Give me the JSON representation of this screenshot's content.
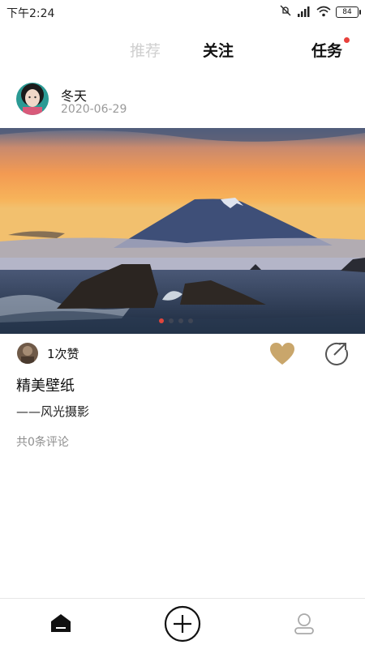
{
  "status_bar": {
    "time": "下午2:24",
    "battery": "84",
    "icons": [
      "mute-icon",
      "signal-icon",
      "wifi-icon",
      "battery-icon"
    ]
  },
  "top_nav": {
    "tabs": [
      {
        "label": "推荐",
        "active": false
      },
      {
        "label": "关注",
        "active": true
      },
      {
        "label": "任务",
        "active": false,
        "badge_dot": true
      }
    ]
  },
  "post": {
    "author": "冬天",
    "date": "2020-06-29",
    "likes_text": "1次赞",
    "title": "精美壁纸",
    "subtitle": "——风光摄影",
    "comments_text": "共0条评论",
    "carousel_pages": 4,
    "carousel_active_index": 0
  },
  "colors": {
    "accent_like": "#c9a66b",
    "badge_red": "#e8413c",
    "inactive_tab": "#cfcfcf"
  },
  "bottom_nav": {
    "items": [
      {
        "icon": "home-icon",
        "active": true
      },
      {
        "icon": "add-circle-icon",
        "active": false
      },
      {
        "icon": "profile-icon",
        "active": false
      }
    ]
  }
}
